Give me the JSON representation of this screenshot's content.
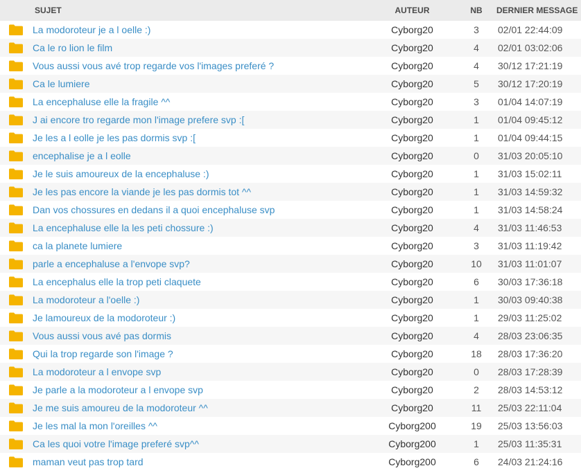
{
  "headers": {
    "subject": "SUJET",
    "author": "AUTEUR",
    "count": "NB",
    "last_message": "DERNIER MESSAGE"
  },
  "icon": "folder-icon",
  "colors": {
    "link": "#3a8ec6",
    "folder": "#f4b400",
    "header_bg": "#ebebeb",
    "row_alt_bg": "#f6f6f6"
  },
  "topics": [
    {
      "subject": "La modoroteur je a l oelle :)",
      "author": "Cyborg20",
      "count": "3",
      "date": "02/01 22:44:09"
    },
    {
      "subject": "Ca le ro lion le film",
      "author": "Cyborg20",
      "count": "4",
      "date": "02/01 03:02:06"
    },
    {
      "subject": "Vous aussi vous avé trop regarde vos l'images preferé ?",
      "author": "Cyborg20",
      "count": "4",
      "date": "30/12 17:21:19"
    },
    {
      "subject": "Ca le lumiere",
      "author": "Cyborg20",
      "count": "5",
      "date": "30/12 17:20:19"
    },
    {
      "subject": "La encephaluse elle la fragile ^^",
      "author": "Cyborg20",
      "count": "3",
      "date": "01/04 14:07:19"
    },
    {
      "subject": "J ai encore tro regarde mon l'image prefere svp :[",
      "author": "Cyborg20",
      "count": "1",
      "date": "01/04 09:45:12"
    },
    {
      "subject": "Je les a l eolle je les pas dormis svp :[",
      "author": "Cyborg20",
      "count": "1",
      "date": "01/04 09:44:15"
    },
    {
      "subject": "encephalise je a l eolle",
      "author": "Cyborg20",
      "count": "0",
      "date": "31/03 20:05:10"
    },
    {
      "subject": "Je le suis amoureux de la encephaluse :)",
      "author": "Cyborg20",
      "count": "1",
      "date": "31/03 15:02:11"
    },
    {
      "subject": "Je les pas encore la viande je les pas dormis tot ^^",
      "author": "Cyborg20",
      "count": "1",
      "date": "31/03 14:59:32"
    },
    {
      "subject": "Dan vos chossures en dedans il a quoi encephaluse svp",
      "author": "Cyborg20",
      "count": "1",
      "date": "31/03 14:58:24"
    },
    {
      "subject": "La encephaluse elle la les peti chossure :)",
      "author": "Cyborg20",
      "count": "4",
      "date": "31/03 11:46:53"
    },
    {
      "subject": "ca la planete lumiere",
      "author": "Cyborg20",
      "count": "3",
      "date": "31/03 11:19:42"
    },
    {
      "subject": "parle a encephaluse a l'envope svp?",
      "author": "Cyborg20",
      "count": "10",
      "date": "31/03 11:01:07"
    },
    {
      "subject": "La encephalus elle la trop peti claquete",
      "author": "Cyborg20",
      "count": "6",
      "date": "30/03 17:36:18"
    },
    {
      "subject": "La modoroteur a l'oelle :)",
      "author": "Cyborg20",
      "count": "1",
      "date": "30/03 09:40:38"
    },
    {
      "subject": "Je lamoureux de la modoroteur :)",
      "author": "Cyborg20",
      "count": "1",
      "date": "29/03 11:25:02"
    },
    {
      "subject": "Vous aussi vous avé pas dormis",
      "author": "Cyborg20",
      "count": "4",
      "date": "28/03 23:06:35"
    },
    {
      "subject": "Qui la trop regarde son l'image ?",
      "author": "Cyborg20",
      "count": "18",
      "date": "28/03 17:36:20"
    },
    {
      "subject": "La modoroteur a l envope svp",
      "author": "Cyborg20",
      "count": "0",
      "date": "28/03 17:28:39"
    },
    {
      "subject": "Je parle a la modoroteur a l envope svp",
      "author": "Cyborg20",
      "count": "2",
      "date": "28/03 14:53:12"
    },
    {
      "subject": "Je me suis amoureu de la modoroteur ^^",
      "author": "Cyborg20",
      "count": "11",
      "date": "25/03 22:11:04"
    },
    {
      "subject": "Je les mal la mon l'oreilles ^^",
      "author": "Cyborg200",
      "count": "19",
      "date": "25/03 13:56:03"
    },
    {
      "subject": "Ca les quoi votre l'image preferé svp^^",
      "author": "Cyborg200",
      "count": "1",
      "date": "25/03 11:35:31"
    },
    {
      "subject": "maman veut pas trop tard",
      "author": "Cyborg200",
      "count": "6",
      "date": "24/03 21:24:16"
    }
  ]
}
